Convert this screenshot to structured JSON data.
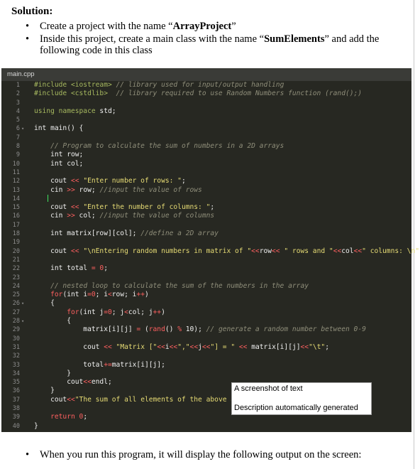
{
  "heading": "Solution:",
  "bullets": [
    {
      "pre": "Create a project with the name “",
      "bold": "ArrayProject",
      "post": "”"
    },
    {
      "pre": "Inside this project, create a main class with the name “",
      "bold": "SumElements",
      "post": "” and add the following code in this class"
    }
  ],
  "editor": {
    "tab_label": "main.cpp",
    "lines": [
      [
        [
          "pp",
          "#include <iostream> "
        ],
        [
          "cm",
          "// library used for input/output handling"
        ]
      ],
      [
        [
          "pp",
          "#include <cstdlib> "
        ],
        [
          "cm",
          " // library required to use Random Numbers function (rand();)"
        ]
      ],
      [],
      [
        [
          "pp",
          "using namespace "
        ],
        [
          "kw",
          "std;"
        ]
      ],
      [],
      [
        [
          "kw",
          "int main() {"
        ]
      ],
      [],
      [
        [
          "kw",
          "    "
        ],
        [
          "cm",
          "// Program to calculate the sum of numbers in a 2D arrays"
        ]
      ],
      [
        [
          "kw",
          "    int row;"
        ]
      ],
      [
        [
          "kw",
          "    int col;"
        ]
      ],
      [],
      [
        [
          "kw",
          "    cout "
        ],
        [
          "op",
          "<<"
        ],
        [
          "str",
          " \"Enter number of rows: \""
        ],
        [
          "kw",
          ";"
        ]
      ],
      [
        [
          "kw",
          "    cin "
        ],
        [
          "op",
          ">>"
        ],
        [
          "kw",
          " row; "
        ],
        [
          "cm",
          "//input the value of rows"
        ]
      ],
      [
        [
          "cursor",
          ""
        ]
      ],
      [
        [
          "kw",
          "    cout "
        ],
        [
          "op",
          "<<"
        ],
        [
          "str",
          " \"Enter the number of columns: \""
        ],
        [
          "kw",
          ";"
        ]
      ],
      [
        [
          "kw",
          "    cin "
        ],
        [
          "op",
          ">>"
        ],
        [
          "kw",
          " col; "
        ],
        [
          "cm",
          "//input the value of columns"
        ]
      ],
      [],
      [
        [
          "kw",
          "    int matrix[row][col]; "
        ],
        [
          "cm",
          "//define a 2D array"
        ]
      ],
      [],
      [
        [
          "kw",
          "    cout "
        ],
        [
          "op",
          "<<"
        ],
        [
          "str",
          " \"\\nEntering random numbers in matrix of \""
        ],
        [
          "op",
          "<<"
        ],
        [
          "kw",
          "row"
        ],
        [
          "op",
          "<<"
        ],
        [
          "str",
          " \" rows and \""
        ],
        [
          "op",
          "<<"
        ],
        [
          "kw",
          "col"
        ],
        [
          "op",
          "<<"
        ],
        [
          "str",
          "\" columns: \\n\""
        ],
        [
          "kw",
          ";"
        ]
      ],
      [],
      [
        [
          "kw",
          "    int total "
        ],
        [
          "op",
          "="
        ],
        [
          "num",
          " 0"
        ],
        [
          "kw",
          ";"
        ]
      ],
      [],
      [
        [
          "kw",
          "    "
        ],
        [
          "cm",
          "// nested loop to calculate the sum of the numbers in the array"
        ]
      ],
      [
        [
          "kw",
          "    "
        ],
        [
          "tk",
          "for"
        ],
        [
          "kw",
          "(int i"
        ],
        [
          "op",
          "="
        ],
        [
          "num",
          "0"
        ],
        [
          "kw",
          "; i"
        ],
        [
          "op",
          "<"
        ],
        [
          "kw",
          "row; i"
        ],
        [
          "op",
          "++"
        ],
        [
          "kw",
          ")"
        ]
      ],
      [
        [
          "kw",
          "    {"
        ]
      ],
      [
        [
          "kw",
          "        "
        ],
        [
          "tk",
          "for"
        ],
        [
          "kw",
          "(int j"
        ],
        [
          "op",
          "="
        ],
        [
          "num",
          "0"
        ],
        [
          "kw",
          "; j"
        ],
        [
          "op",
          "<"
        ],
        [
          "kw",
          "col; j"
        ],
        [
          "op",
          "++"
        ],
        [
          "kw",
          ")"
        ]
      ],
      [
        [
          "kw",
          "        {"
        ]
      ],
      [
        [
          "kw",
          "            matrix[i][j] "
        ],
        [
          "op",
          "="
        ],
        [
          "kw",
          " ("
        ],
        [
          "fn",
          "rand"
        ],
        [
          "kw",
          "() "
        ],
        [
          "op",
          "%"
        ],
        [
          "kw",
          " 10); "
        ],
        [
          "cm",
          "// generate a random number between 0-9"
        ]
      ],
      [],
      [
        [
          "kw",
          "            cout "
        ],
        [
          "op",
          "<<"
        ],
        [
          "str",
          " \"Matrix [\""
        ],
        [
          "op",
          "<<"
        ],
        [
          "kw",
          "i"
        ],
        [
          "op",
          "<<"
        ],
        [
          "str",
          "\",\""
        ],
        [
          "op",
          "<<"
        ],
        [
          "kw",
          "j"
        ],
        [
          "op",
          "<<"
        ],
        [
          "str",
          "\"] = \""
        ],
        [
          "op",
          " <<"
        ],
        [
          "kw",
          " matrix[i][j]"
        ],
        [
          "op",
          "<<"
        ],
        [
          "str",
          "\"\\t\""
        ],
        [
          "kw",
          ";"
        ]
      ],
      [],
      [
        [
          "kw",
          "            total"
        ],
        [
          "op",
          "+="
        ],
        [
          "kw",
          "matrix[i][j];"
        ]
      ],
      [
        [
          "kw",
          "        }"
        ]
      ],
      [
        [
          "kw",
          "        cout"
        ],
        [
          "op",
          "<<"
        ],
        [
          "kw",
          "endl;"
        ]
      ],
      [
        [
          "kw",
          "    }"
        ]
      ],
      [
        [
          "kw",
          "    cout"
        ],
        [
          "op",
          "<<"
        ],
        [
          "str",
          "\"The sum of all elements of the above arra"
        ]
      ],
      [],
      [
        [
          "kw",
          "    "
        ],
        [
          "tk",
          "return"
        ],
        [
          "num",
          " 0"
        ],
        [
          "kw",
          ";"
        ]
      ],
      [
        [
          "kw",
          "}"
        ]
      ]
    ],
    "folds": [
      "6",
      "26",
      "28"
    ]
  },
  "tooltip": {
    "line1": "A screenshot of text",
    "line2": "Description automatically generated"
  },
  "footer": "When you run this program, it will display the following output on the screen:"
}
